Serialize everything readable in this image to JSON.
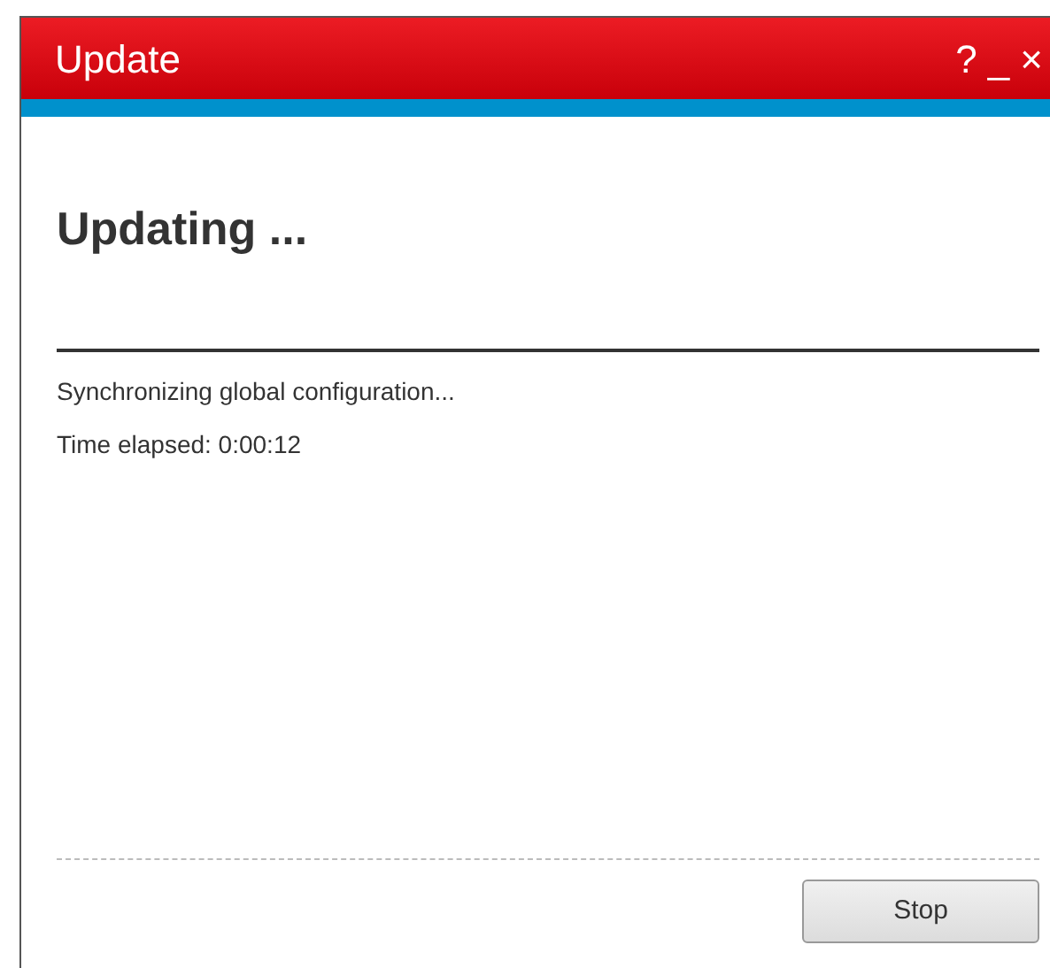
{
  "window": {
    "title": "Update",
    "title_buttons": [
      "?",
      "_",
      "×"
    ]
  },
  "heading": "Updating ...",
  "messages": [
    "Synchronizing global configuration...",
    "Time elapsed: 0:00:12"
  ],
  "buttons": [
    "Stop"
  ]
}
